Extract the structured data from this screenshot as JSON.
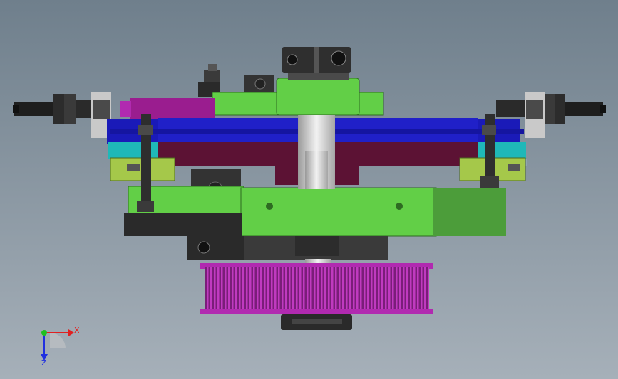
{
  "colors": {
    "bg_top": "#6f7f8c",
    "bg_bottom": "#a6b0b9",
    "green": "#62cf47",
    "green_light": "#7fd85a",
    "green_dark": "#4c9d3a",
    "olive": "#a5c84a",
    "blue": "#1a1ab8",
    "maroon": "#5c1234",
    "magenta": "#9a1d8f",
    "pink": "#b12ab0",
    "cyan": "#1fb8b8",
    "dark": "#2a2a2a",
    "gray": "#8a8f94",
    "silver": "#d8d8d8",
    "axis_x": "#e02020",
    "axis_y": "#20c020",
    "axis_z": "#2030e0"
  },
  "triad": {
    "x_label": "X",
    "z_label": "Z"
  }
}
